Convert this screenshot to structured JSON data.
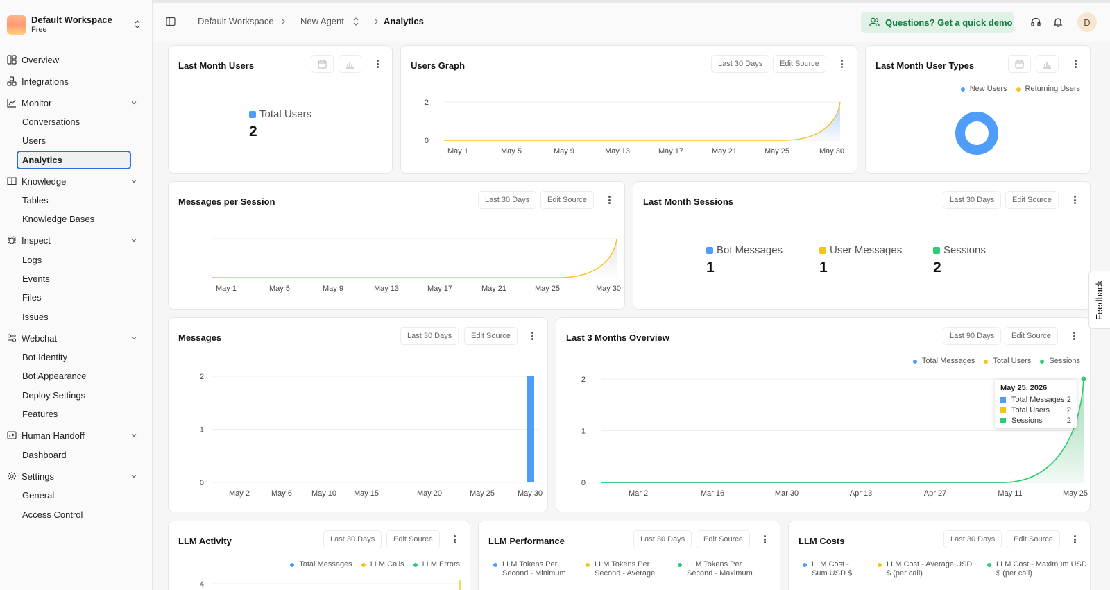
{
  "workspace": {
    "name": "Default Workspace",
    "plan": "Free"
  },
  "sidebar": {
    "overview": "Overview",
    "integrations": "Integrations",
    "monitor": {
      "label": "Monitor",
      "items": [
        "Conversations",
        "Users",
        "Analytics"
      ]
    },
    "knowledge": {
      "label": "Knowledge",
      "items": [
        "Tables",
        "Knowledge Bases"
      ]
    },
    "inspect": {
      "label": "Inspect",
      "items": [
        "Logs",
        "Events",
        "Files",
        "Issues"
      ]
    },
    "webchat": {
      "label": "Webchat",
      "items": [
        "Bot Identity",
        "Bot Appearance",
        "Deploy Settings",
        "Features"
      ]
    },
    "handoff": {
      "label": "Human Handoff",
      "items": [
        "Dashboard"
      ]
    },
    "settings": {
      "label": "Settings",
      "items": [
        "General",
        "Access Control"
      ]
    }
  },
  "topbar": {
    "breadcrumb": [
      "Default Workspace",
      "New Agent",
      "Analytics"
    ],
    "demo_label": "Questions? Get a quick demo",
    "avatar_initial": "D"
  },
  "common": {
    "last30": "Last 30 Days",
    "last90": "Last 90 Days",
    "edit_source": "Edit Source"
  },
  "colors": {
    "blue": "#4f9cf9",
    "yellow": "#f7c21b",
    "green": "#2ecc71",
    "accent": "#2f6fd6"
  },
  "cards": {
    "last_month_users": {
      "title": "Last Month Users",
      "stat_label": "Total Users",
      "stat_value": "2"
    },
    "users_graph": {
      "title": "Users Graph"
    },
    "user_types": {
      "title": "Last Month User Types",
      "legend": [
        "New Users",
        "Returning Users"
      ]
    },
    "msgs_per_session": {
      "title": "Messages per Session"
    },
    "last_month_sessions": {
      "title": "Last Month Sessions",
      "stats": [
        {
          "label": "Bot Messages",
          "value": "1"
        },
        {
          "label": "User Messages",
          "value": "1"
        },
        {
          "label": "Sessions",
          "value": "2"
        }
      ]
    },
    "messages": {
      "title": "Messages"
    },
    "overview3m": {
      "title": "Last 3 Months Overview",
      "legend": [
        "Total Messages",
        "Total Users",
        "Sessions"
      ]
    },
    "llm_activity": {
      "title": "LLM Activity",
      "legend": [
        "Total Messages",
        "LLM Calls",
        "LLM Errors"
      ]
    },
    "llm_performance": {
      "title": "LLM Performance",
      "legend": [
        [
          "LLM Tokens Per",
          "Second - Minimum"
        ],
        [
          "LLM Tokens Per",
          "Second - Average"
        ],
        [
          "LLM Tokens Per",
          "Second - Maximum"
        ]
      ]
    },
    "llm_costs": {
      "title": "LLM Costs",
      "legend": [
        [
          "LLM Cost -",
          "Sum USD $"
        ],
        [
          "LLM Cost - Average USD",
          "$ (per call)"
        ],
        [
          "LLM Cost - Maximum USD",
          "$ (per call)"
        ]
      ]
    }
  },
  "tooltip": {
    "date": "May 25, 2026",
    "rows": [
      {
        "name": "Total Messages",
        "value": "2"
      },
      {
        "name": "Total Users",
        "value": "2"
      },
      {
        "name": "Sessions",
        "value": "2"
      }
    ]
  },
  "feedback_label": "Feedback",
  "chart_data": [
    {
      "type": "area",
      "id": "users_graph",
      "x": [
        "May 1",
        "May 5",
        "May 9",
        "May 13",
        "May 17",
        "May 21",
        "May 25",
        "May 30"
      ],
      "y_ticks": [
        0,
        2
      ],
      "ylim": [
        0,
        2
      ],
      "series": [
        {
          "values": [
            0,
            0,
            0,
            0,
            0,
            0,
            0,
            2
          ]
        }
      ]
    },
    {
      "type": "pie",
      "id": "user_types",
      "categories": [
        "New Users",
        "Returning Users"
      ],
      "values": [
        2,
        0
      ]
    },
    {
      "type": "area",
      "id": "msgs_per_session",
      "x": [
        "May 1",
        "May 5",
        "May 9",
        "May 13",
        "May 17",
        "May 21",
        "May 25",
        "May 30"
      ],
      "series": [
        {
          "values": [
            0,
            0,
            0,
            0,
            0,
            0,
            0,
            1
          ]
        }
      ]
    },
    {
      "type": "bar",
      "id": "messages",
      "x": [
        "May 2",
        "May 6",
        "May 10",
        "May 15",
        "May 20",
        "May 25",
        "May 30"
      ],
      "y_ticks": [
        0,
        1,
        2
      ],
      "ylim": [
        0,
        2
      ],
      "bar": {
        "x": "May 30",
        "value": 2
      }
    },
    {
      "type": "area",
      "id": "overview3m",
      "x": [
        "Mar 2",
        "Mar 16",
        "Mar 30",
        "Apr 13",
        "Apr 27",
        "May 11",
        "May 25"
      ],
      "y_ticks": [
        0,
        1,
        2
      ],
      "ylim": [
        0,
        2
      ],
      "series": [
        {
          "name": "Total Messages",
          "values": [
            0,
            0,
            0,
            0,
            0,
            0,
            2
          ]
        },
        {
          "name": "Total Users",
          "values": [
            0,
            0,
            0,
            0,
            0,
            0,
            2
          ]
        },
        {
          "name": "Sessions",
          "values": [
            0,
            0,
            0,
            0,
            0,
            0,
            2
          ]
        }
      ]
    },
    {
      "type": "line",
      "id": "llm_activity",
      "y_ticks": [
        4
      ]
    }
  ]
}
